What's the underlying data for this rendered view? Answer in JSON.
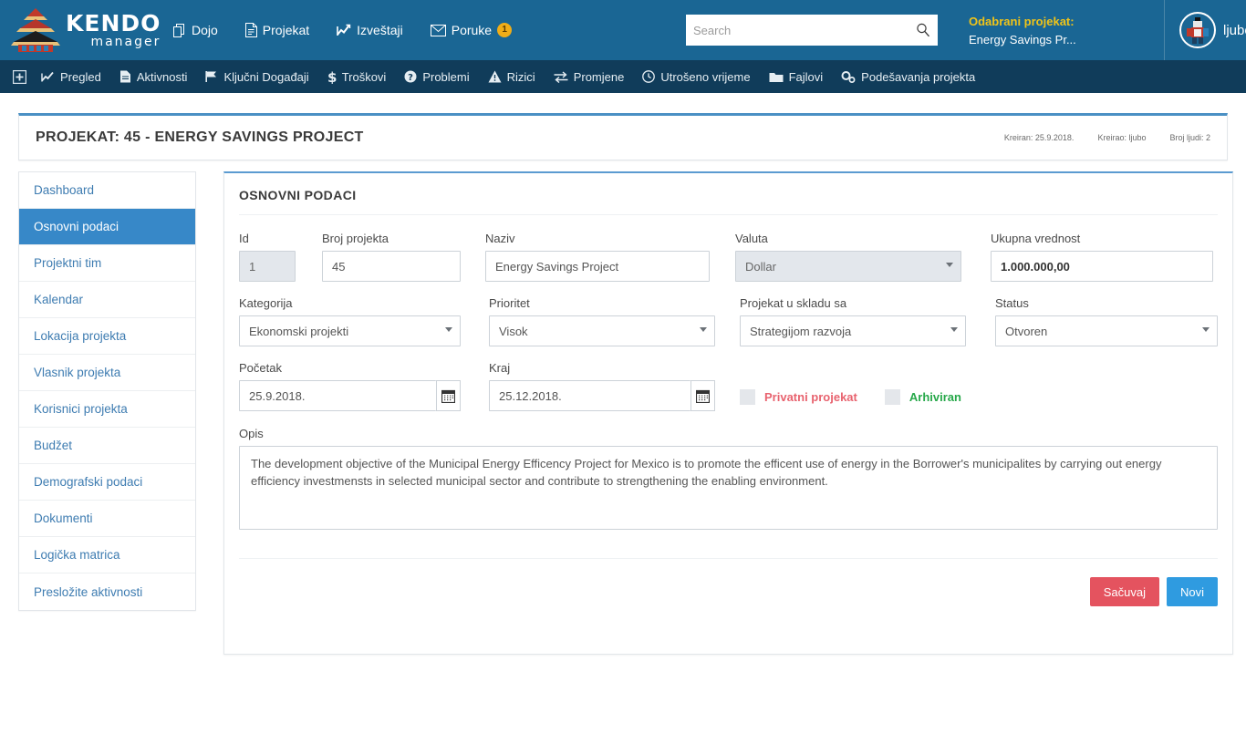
{
  "header": {
    "logo": {
      "brand_top": "KENDO",
      "brand_bottom": "manager",
      "icon": "pagoda-logo-icon"
    },
    "nav": [
      {
        "label": "Dojo",
        "icon": "copy-icon"
      },
      {
        "label": "Projekat",
        "icon": "document-icon"
      },
      {
        "label": "Izveštaji",
        "icon": "chart-line-icon"
      },
      {
        "label": "Poruke",
        "icon": "envelope-icon",
        "badge": "1"
      }
    ],
    "search": {
      "placeholder": "Search",
      "value": "",
      "icon": "search-icon"
    },
    "selected_project": {
      "label": "Odabrani projekat:",
      "value": "Energy Savings Pr..."
    },
    "user": {
      "name": "ljubo",
      "avatar": "kendo-avatar"
    }
  },
  "subnav": {
    "grid_icon": "grid-plus-icon",
    "items": [
      {
        "label": "Pregled",
        "icon": "chart-line-icon"
      },
      {
        "label": "Aktivnosti",
        "icon": "tasks-icon"
      },
      {
        "label": "Ključni Događaji",
        "icon": "flag-icon"
      },
      {
        "label": "Troškovi",
        "icon": "dollar-icon"
      },
      {
        "label": "Problemi",
        "icon": "question-circle-icon"
      },
      {
        "label": "Rizici",
        "icon": "warning-triangle-icon"
      },
      {
        "label": "Promjene",
        "icon": "exchange-icon"
      },
      {
        "label": "Utrošeno vrijeme",
        "icon": "clock-icon"
      },
      {
        "label": "Fajlovi",
        "icon": "folder-icon"
      },
      {
        "label": "Podešavanja projekta",
        "icon": "gears-icon"
      }
    ]
  },
  "project_header": {
    "title": "PROJEKAT: 45 - ENERGY SAVINGS PROJECT",
    "meta": [
      "Kreiran: 25.9.2018.",
      "Kreirao: ljubo",
      "Broj ljudi: 2"
    ]
  },
  "sidebar": {
    "items": [
      {
        "label": "Dashboard",
        "active": false
      },
      {
        "label": "Osnovni podaci",
        "active": true
      },
      {
        "label": "Projektni tim",
        "active": false
      },
      {
        "label": "Kalendar",
        "active": false
      },
      {
        "label": "Lokacija projekta",
        "active": false
      },
      {
        "label": "Vlasnik projekta",
        "active": false
      },
      {
        "label": "Korisnici projekta",
        "active": false
      },
      {
        "label": "Budžet",
        "active": false
      },
      {
        "label": "Demografski podaci",
        "active": false
      },
      {
        "label": "Dokumenti",
        "active": false
      },
      {
        "label": "Logička matrica",
        "active": false
      },
      {
        "label": "Presložite aktivnosti",
        "active": false
      }
    ]
  },
  "panel": {
    "title": "OSNOVNI PODACI",
    "fields": {
      "id": {
        "label": "Id",
        "value": "1"
      },
      "broj_projekta": {
        "label": "Broj projekta",
        "value": "45"
      },
      "naziv": {
        "label": "Naziv",
        "value": "Energy Savings Project"
      },
      "valuta": {
        "label": "Valuta",
        "value": "Dollar"
      },
      "ukupna_vrednost": {
        "label": "Ukupna vrednost",
        "value": "1.000.000,00"
      },
      "kategorija": {
        "label": "Kategorija",
        "value": "Ekonomski projekti"
      },
      "prioritet": {
        "label": "Prioritet",
        "value": "Visok"
      },
      "projekat_u_skladu_sa": {
        "label": "Projekat u skladu sa",
        "value": "Strategijom razvoja"
      },
      "status": {
        "label": "Status",
        "value": "Otvoren"
      },
      "pocetak": {
        "label": "Početak",
        "value": "25.9.2018."
      },
      "kraj": {
        "label": "Kraj",
        "value": "25.12.2018."
      },
      "privatni_projekat": {
        "label": "Privatni projekat",
        "checked": false
      },
      "arhiviran": {
        "label": "Arhiviran",
        "checked": false
      },
      "opis": {
        "label": "Opis",
        "value": "The development objective of the Municipal Energy Efficency Project for Mexico is to promote the efficent use of energy in the Borrower's municipalites by carrying out energy efficiency investmensts in selected municipal sector and contribute to strengthening the enabling environment."
      }
    },
    "buttons": {
      "save": "Sačuvaj",
      "new": "Novi"
    }
  },
  "colors": {
    "header_blue": "#1a6694",
    "subnav_blue": "#103c5a",
    "accent_blue": "#3788c8",
    "link_blue": "#3e7cb1",
    "gold": "#f0c419",
    "save_red": "#e4535f",
    "new_blue": "#2f9be0",
    "private_red": "#e8636f",
    "archived_green": "#27a84a"
  }
}
